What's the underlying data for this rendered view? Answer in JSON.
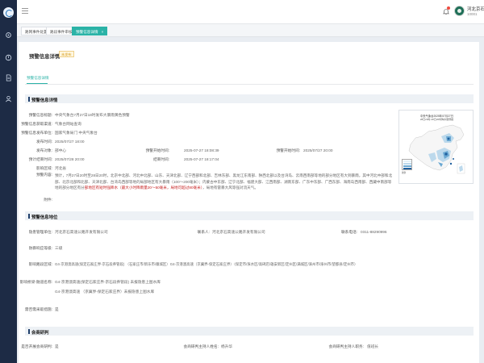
{
  "sidebar": {
    "icons": [
      "app-logo",
      "gear-icon",
      "document-icon",
      "user-icon"
    ]
  },
  "topbar": {
    "user_name": "河北京石...",
    "user_sub": "10001"
  },
  "tabs": [
    {
      "label": "路网事件处置"
    },
    {
      "label": "路段事件审核"
    },
    {
      "label": "预警信息详情",
      "close": "×"
    }
  ],
  "page": {
    "title": "预警信息详情",
    "badge": "未发布",
    "inner_tab": "预警信息详情"
  },
  "section_warning": {
    "title": "预警信息详情",
    "fields": {
      "title_label": "预警信息标题:",
      "title_value": "中央气象台7月27日18时发布大暴雨黄色预警",
      "source_label": "预警信息获取渠道:",
      "source_value": "气象台网站查询",
      "org_label": "预警信息发布单位:",
      "org_value": "国家气象局门 中央气象台",
      "issue_time_label": "发布时间:",
      "issue_time_value": "2025/07/27 18:00",
      "level_label": "预警级别:",
      "level_value": "黄色",
      "valid_start_label": "预警开始时间:",
      "valid_start_value": "2025-07-27 18:08:39",
      "publish_label": "发布对象:",
      "publish_value": "部中心",
      "start_time_label": "预警开始时间:",
      "start_time_value": "2025/07/27 20:00",
      "expect_label": "预计结束时间:",
      "expect_value": "2025/07/28 20:00",
      "end_label": "结束时间:",
      "end_value": "2025-07-27 18:17:04",
      "region_label": "影响区域:",
      "region_value": "河北省",
      "content_label": "预警内容:",
      "attach_label": "附件:"
    },
    "content_pre": "预计，7月27日20时至28日20时，北京中北部、河北中北部、山东、天津北部、辽宁西部和北部、吉林东部、黑龙江东南部、陕西北部以及台湾岛、云南西南部等地的部分地区有大到暴雨，其中河北中部和北部、北京北部和北部、天津北部、台湾岛西部等地的局部地区有大暴雨（100～200毫米）；内蒙古中东部、辽宁北部、福建大部、江西南部、湖南东部、广东中东部、广西东部、海南岛西南部、西藏中南部等地的部分地区有分",
    "content_hl": "部地区有短时强降水（最大小时降雨量20～50毫米，局地可超过80毫米）",
    "content_post": "，局地有雷暴大风等强对流天气。"
  },
  "map": {
    "title": "中央气象台2025年07月27日",
    "subtitle": "28日20时-28日20时降水量预报",
    "legend_label": "图例"
  },
  "section_location": {
    "title": "预警信息地位",
    "fields": {
      "unit_label": "隐患管理单位:",
      "unit_value": "河北京石高速公路开发有限公司",
      "contact_label": "联系人:",
      "contact_value": "河北京石高速公路开发有限公司",
      "phone_label": "联系电话:",
      "phone_value": "0311-88290996",
      "rank_label": "防御响应等级:",
      "rank_value": "三级",
      "roads_label": "影响路段区域:",
      "roads_value": "G4-京港澳高速(保定石家庄界-京石段养管段) （石家庄市/新乐市/藁城区）G4-京港澳高速（京冀界-保定石家庄界）（保定市/涿水区/高碑店/雄安新区/定州区/满城区/涿州市/涿州市/望都县/定州市）",
      "sites_label": "影响桥梁-隧道名称:",
      "sites_line1": "G4-京港澳高速(保定石家庄界-京石段养管段) 未报隐患上图水库",
      "sites_line2": "G4-京港澳高速 （京冀界-保定石家庄界）未报隐患上图水库",
      "detour_label": "需否需采取措施:",
      "detour_value": "是"
    }
  },
  "section_meeting": {
    "title": "会商研判",
    "fields": {
      "meeting_label": "是否开展会商研判:",
      "meeting_value": "是",
      "head_label": "会商研判主持人姓名:",
      "head_value": "杨升华",
      "role_label": "会商研判主持人职务:",
      "role_value": "值班长"
    }
  },
  "colors": {
    "accent": "#2bb3a7",
    "sidebar": "#1d2b45",
    "warning": "#c41a1a"
  }
}
